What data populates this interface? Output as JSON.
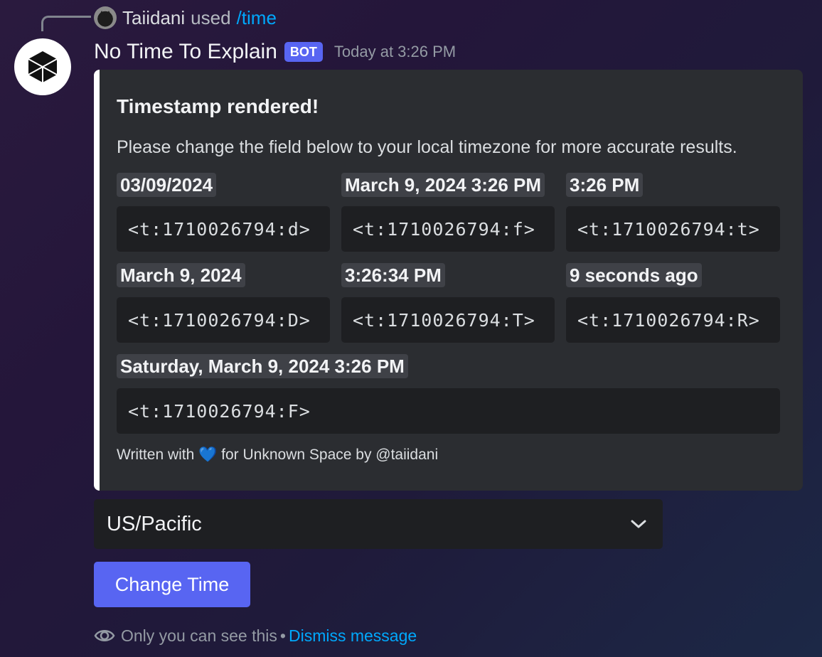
{
  "reply": {
    "username": "Taiidani",
    "used_text": "used",
    "command": "/time"
  },
  "message": {
    "bot_name": "No Time To Explain",
    "bot_badge": "BOT",
    "timestamp": "Today at 3:26 PM"
  },
  "embed": {
    "border_color": "#ffffff",
    "title": "Timestamp rendered!",
    "description": "Please change the field below to your local timezone for more accurate results.",
    "fields": [
      {
        "label": "03/09/2024",
        "code": "<t:1710026794:d>"
      },
      {
        "label": "March 9, 2024 3:26 PM",
        "code": "<t:1710026794:f>"
      },
      {
        "label": "3:26 PM",
        "code": "<t:1710026794:t>"
      },
      {
        "label": "March 9, 2024",
        "code": "<t:1710026794:D>"
      },
      {
        "label": "3:26:34 PM",
        "code": "<t:1710026794:T>"
      },
      {
        "label": "9 seconds ago",
        "code": "<t:1710026794:R>"
      },
      {
        "label": "Saturday, March 9, 2024 3:26 PM",
        "code": "<t:1710026794:F>"
      }
    ],
    "footer_prefix": "Written with",
    "footer_heart": "💙",
    "footer_suffix": "for Unknown Space by @taiidani"
  },
  "timezone_select": {
    "value": "US/Pacific",
    "icon": "chevron-down-icon"
  },
  "change_button": {
    "label": "Change Time",
    "color": "#5865f2"
  },
  "ephemeral": {
    "icon": "eye-icon",
    "text": "Only you can see this",
    "separator": "•",
    "dismiss": "Dismiss message"
  }
}
